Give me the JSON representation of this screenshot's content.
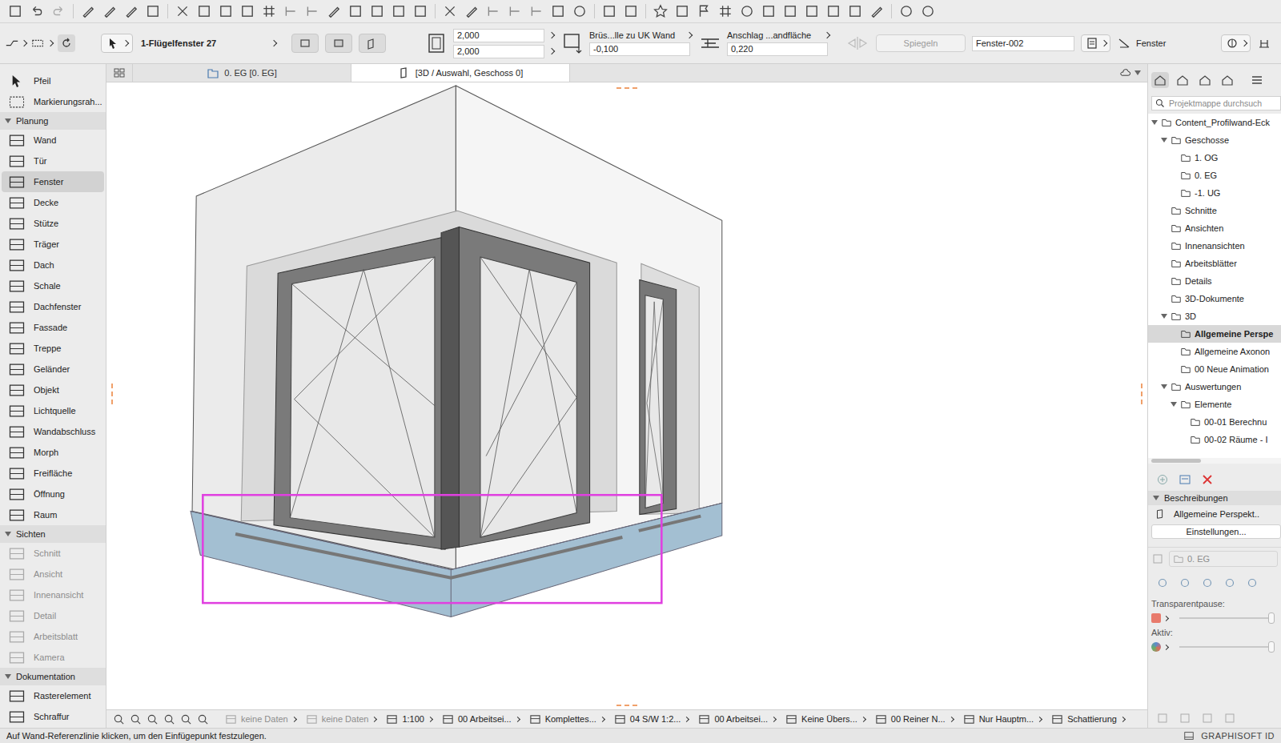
{
  "info_box": {
    "element": "1-Flügelfenster 27",
    "width": "2,000",
    "height": "2,000",
    "sill_label": "Brüs...lle zu UK Wand",
    "sill_value": "-0,100",
    "reveal_label": "Anschlag ...andfläche",
    "reveal_value": "0,220",
    "mirror_button": {
      "label": "Spiegeln",
      "disabled": true
    },
    "id": "Fenster-002",
    "type_label": "Fenster"
  },
  "view_tabs": [
    {
      "label": "0. EG [0. EG]",
      "selected": false
    },
    {
      "label": "[3D / Auswahl, Geschoss 0]",
      "selected": true
    }
  ],
  "toolbox": {
    "top_items": [
      {
        "label": "Pfeil",
        "selected": false
      },
      {
        "label": "Markierungsrah...",
        "selected": false
      }
    ],
    "sections": [
      {
        "title": "Planung",
        "expanded": true,
        "items": [
          {
            "label": "Wand",
            "selected": false,
            "disabled": false
          },
          {
            "label": "Tür",
            "selected": false,
            "disabled": false
          },
          {
            "label": "Fenster",
            "selected": true,
            "disabled": false
          },
          {
            "label": "Decke",
            "selected": false,
            "disabled": false
          },
          {
            "label": "Stütze",
            "selected": false,
            "disabled": false
          },
          {
            "label": "Träger",
            "selected": false,
            "disabled": false
          },
          {
            "label": "Dach",
            "selected": false,
            "disabled": false
          },
          {
            "label": "Schale",
            "selected": false,
            "disabled": false
          },
          {
            "label": "Dachfenster",
            "selected": false,
            "disabled": false
          },
          {
            "label": "Fassade",
            "selected": false,
            "disabled": false
          },
          {
            "label": "Treppe",
            "selected": false,
            "disabled": false
          },
          {
            "label": "Geländer",
            "selected": false,
            "disabled": false
          },
          {
            "label": "Objekt",
            "selected": false,
            "disabled": false
          },
          {
            "label": "Lichtquelle",
            "selected": false,
            "disabled": false
          },
          {
            "label": "Wandabschluss",
            "selected": false,
            "disabled": false
          },
          {
            "label": "Morph",
            "selected": false,
            "disabled": false
          },
          {
            "label": "Freifläche",
            "selected": false,
            "disabled": false
          },
          {
            "label": "Öffnung",
            "selected": false,
            "disabled": false
          },
          {
            "label": "Raum",
            "selected": false,
            "disabled": false
          }
        ]
      },
      {
        "title": "Sichten",
        "expanded": true,
        "items": [
          {
            "label": "Schnitt",
            "selected": false,
            "disabled": true
          },
          {
            "label": "Ansicht",
            "selected": false,
            "disabled": true
          },
          {
            "label": "Innenansicht",
            "selected": false,
            "disabled": true
          },
          {
            "label": "Detail",
            "selected": false,
            "disabled": true
          },
          {
            "label": "Arbeitsblatt",
            "selected": false,
            "disabled": true
          },
          {
            "label": "Kamera",
            "selected": false,
            "disabled": true
          }
        ]
      },
      {
        "title": "Dokumentation",
        "expanded": true,
        "items": [
          {
            "label": "Rasterelement",
            "selected": false,
            "disabled": false
          },
          {
            "label": "Schraffur",
            "selected": false,
            "disabled": false
          }
        ]
      }
    ]
  },
  "navigator": {
    "search_placeholder": "Projektmappe durchsuch",
    "tree": [
      {
        "label": "Content_Profilwand-Eck",
        "level": 0,
        "expanded": true,
        "selected": false
      },
      {
        "label": "Geschosse",
        "level": 1,
        "expanded": true,
        "selected": false
      },
      {
        "label": "1. OG",
        "level": 2,
        "selected": false
      },
      {
        "label": "0. EG",
        "level": 2,
        "selected": false
      },
      {
        "label": "-1. UG",
        "level": 2,
        "selected": false
      },
      {
        "label": "Schnitte",
        "level": 1,
        "selected": false
      },
      {
        "label": "Ansichten",
        "level": 1,
        "selected": false
      },
      {
        "label": "Innenansichten",
        "level": 1,
        "selected": false
      },
      {
        "label": "Arbeitsblätter",
        "level": 1,
        "selected": false
      },
      {
        "label": "Details",
        "level": 1,
        "selected": false
      },
      {
        "label": "3D-Dokumente",
        "level": 1,
        "selected": false
      },
      {
        "label": "3D",
        "level": 1,
        "expanded": true,
        "selected": false
      },
      {
        "label": "Allgemeine Perspe",
        "level": 2,
        "selected": true
      },
      {
        "label": "Allgemeine Axonon",
        "level": 2,
        "selected": false
      },
      {
        "label": "00 Neue Animation",
        "level": 2,
        "selected": false
      },
      {
        "label": "Auswertungen",
        "level": 1,
        "expanded": true,
        "selected": false
      },
      {
        "label": "Elemente",
        "level": 2,
        "expanded": true,
        "selected": false
      },
      {
        "label": "00-01 Berechnu",
        "level": 3,
        "selected": false
      },
      {
        "label": "00-02 Räume - I",
        "level": 3,
        "selected": false
      }
    ],
    "descriptions": {
      "title": "Beschreibungen",
      "expanded": true,
      "item": "Allgemeine Perspekt..",
      "settings_button": "Einstellungen...",
      "story_field": {
        "value": "0. EG",
        "disabled": true
      }
    },
    "transparent_trace": {
      "label": "Transparentpause:",
      "level": 1
    },
    "active": {
      "label": "Aktiv:",
      "level": 1
    }
  },
  "status_bar": {
    "items": [
      {
        "label": "keine Daten",
        "disabled": true
      },
      {
        "label": "keine Daten",
        "disabled": true
      },
      {
        "label": "1:100",
        "disabled": false
      },
      {
        "label": "00 Arbeitsei...",
        "disabled": false
      },
      {
        "label": "Komplettes...",
        "disabled": false
      },
      {
        "label": "04 S/W 1:2...",
        "disabled": false
      },
      {
        "label": "00 Arbeitsei...",
        "disabled": false
      },
      {
        "label": "Keine Übers...",
        "disabled": false
      },
      {
        "label": "00 Reiner N...",
        "disabled": false
      },
      {
        "label": "Nur Hauptm...",
        "disabled": false
      },
      {
        "label": "Schattierung",
        "disabled": false
      }
    ]
  },
  "message_bar": {
    "hint": "Auf Wand-Referenzlinie klicken, um den Einfügepunkt festzulegen.",
    "brand": "GRAPHISOFT ID"
  }
}
